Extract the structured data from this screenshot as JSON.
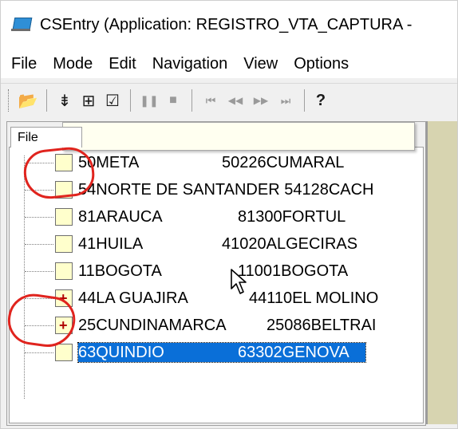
{
  "window": {
    "title": "CSEntry (Application: REGISTRO_VTA_CAPTURA -"
  },
  "menu": [
    "File",
    "Mode",
    "Edit",
    "Navigation",
    "View",
    "Options"
  ],
  "toolbar": {
    "open": "📂",
    "add_case": "⇟",
    "insert_case": "⊞",
    "verify": "☑",
    "pause": "❚❚",
    "stop": "■",
    "first": "⏮",
    "prev": "◀◀",
    "next": "▶▶",
    "last": "⏭",
    "help": "?"
  },
  "panel": {
    "tab_label": "File"
  },
  "tree": [
    {
      "col1": "50META",
      "col2": "50226CUMARAL",
      "mark": ""
    },
    {
      "col1": "54NORTE DE SANTANDER",
      "col2": "54128CACH",
      "mark": ""
    },
    {
      "col1": "81ARAUCA",
      "col2": "81300FORTUL",
      "mark": ""
    },
    {
      "col1": "41HUILA",
      "col2": "41020ALGECIRAS",
      "mark": ""
    },
    {
      "col1": "11BOGOTA",
      "col2": "11001BOGOTA",
      "mark": ""
    },
    {
      "col1": "44LA GUAJIRA",
      "col2": "44110EL MOLINO",
      "mark": "+"
    },
    {
      "col1": "25CUNDINAMARCA",
      "col2": "25086BELTRAI",
      "mark": "+"
    },
    {
      "col1": "63QUINDIO",
      "col2": "63302GENOVA",
      "mark": ""
    }
  ],
  "colors": {
    "selection": "#0a6fd8",
    "annotation": "#e0241e",
    "case_box": "#ffffcc"
  }
}
